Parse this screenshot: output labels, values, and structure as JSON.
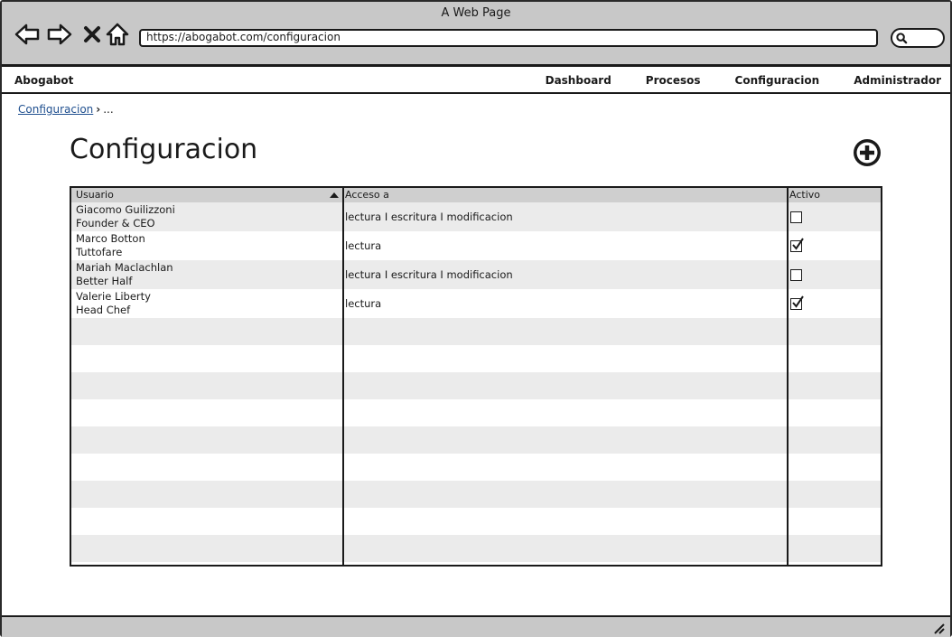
{
  "window": {
    "title": "A Web Page"
  },
  "browser": {
    "url": "https://abogabot.com/configuracion",
    "back_icon": "arrow-left-icon",
    "forward_icon": "arrow-right-icon",
    "close_icon": "close-icon",
    "home_icon": "home-icon",
    "search_icon": "search-icon"
  },
  "appnav": {
    "brand": "Abogabot",
    "links": [
      "Dashboard",
      "Procesos",
      "Configuracion",
      "Administrador"
    ]
  },
  "breadcrumb": {
    "current": "Configuracion",
    "rest": "..."
  },
  "page": {
    "title": "Configuracion",
    "add_icon": "plus-circle-icon"
  },
  "table": {
    "columns": [
      "Usuario",
      "Acceso a",
      "Activo"
    ],
    "sort": {
      "column": "Usuario",
      "direction": "ascending"
    },
    "rows": [
      {
        "name": "Giacomo Guilizzoni",
        "role": "Founder & CEO",
        "acceso": "lectura I escritura I modificacion",
        "activo": false
      },
      {
        "name": "Marco Botton",
        "role": "Tuttofare",
        "acceso": "lectura",
        "activo": true
      },
      {
        "name": "Mariah Maclachlan",
        "role": "Better Half",
        "acceso": "lectura I escritura I modificacion",
        "activo": false
      },
      {
        "name": "Valerie Liberty",
        "role": "Head Chef",
        "acceso": "lectura",
        "activo": true
      }
    ]
  },
  "colors": {
    "chrome": "#c8c8c8",
    "header": "#cfcfcf",
    "row_shade": "#ebebeb",
    "link": "#1f4f8f"
  }
}
